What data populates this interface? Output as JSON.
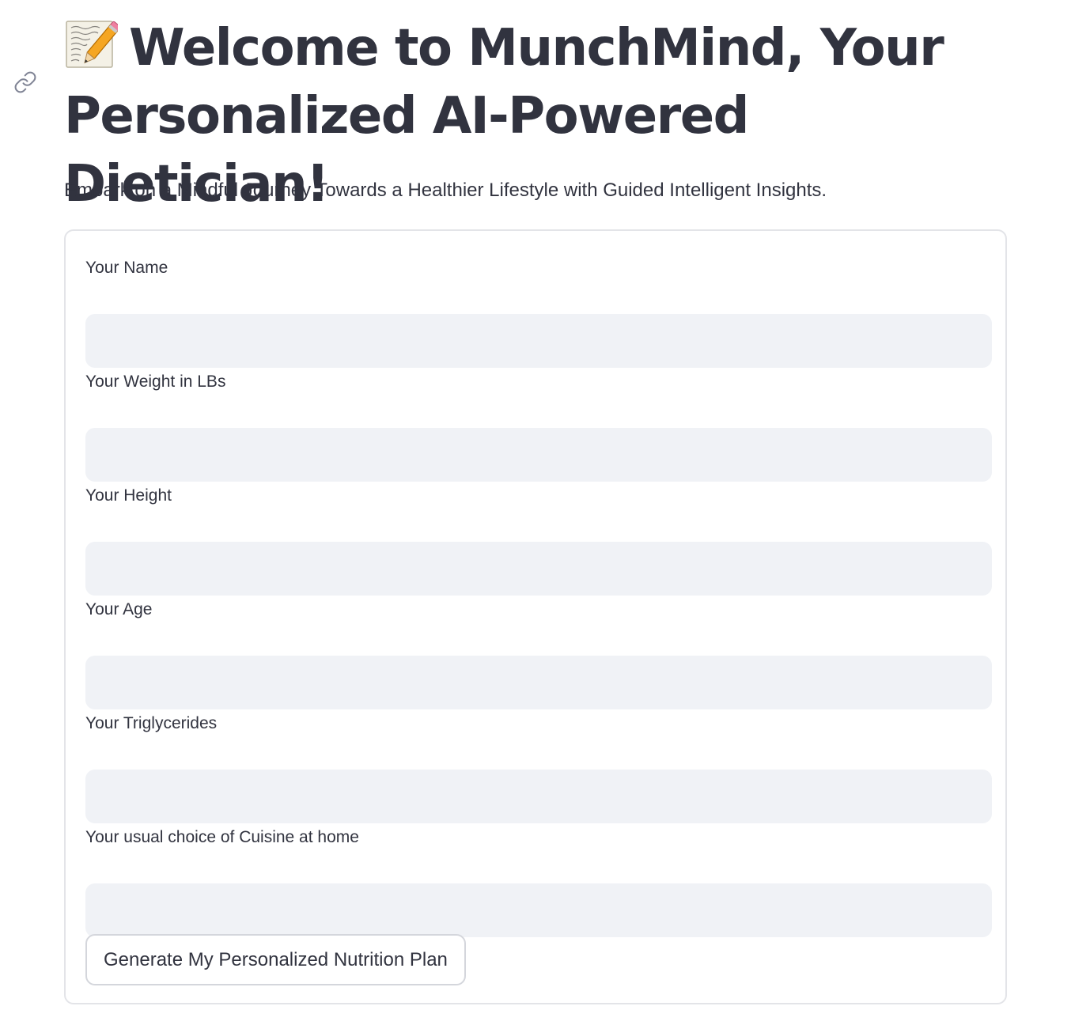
{
  "header": {
    "anchor_icon": "link-icon",
    "title_icon": "memo-icon",
    "title": "Welcome to MunchMind, Your Personalized AI-Powered Dietician!",
    "subtitle": "Embark on a Mindful Journey Towards a Healthier Lifestyle with Guided Intelligent Insights."
  },
  "form": {
    "fields": [
      {
        "label": "Your Name",
        "value": ""
      },
      {
        "label": "Your Weight in LBs",
        "value": ""
      },
      {
        "label": "Your Height",
        "value": ""
      },
      {
        "label": "Your Age",
        "value": ""
      },
      {
        "label": "Your Triglycerides",
        "value": ""
      },
      {
        "label": "Your usual choice of Cuisine at home",
        "value": ""
      }
    ],
    "submit_label": "Generate My Personalized Nutrition Plan"
  },
  "colors": {
    "text": "#31333f",
    "input_background": "#f0f2f6",
    "card_border": "#e3e4e8",
    "button_border": "#d4d6dc"
  }
}
